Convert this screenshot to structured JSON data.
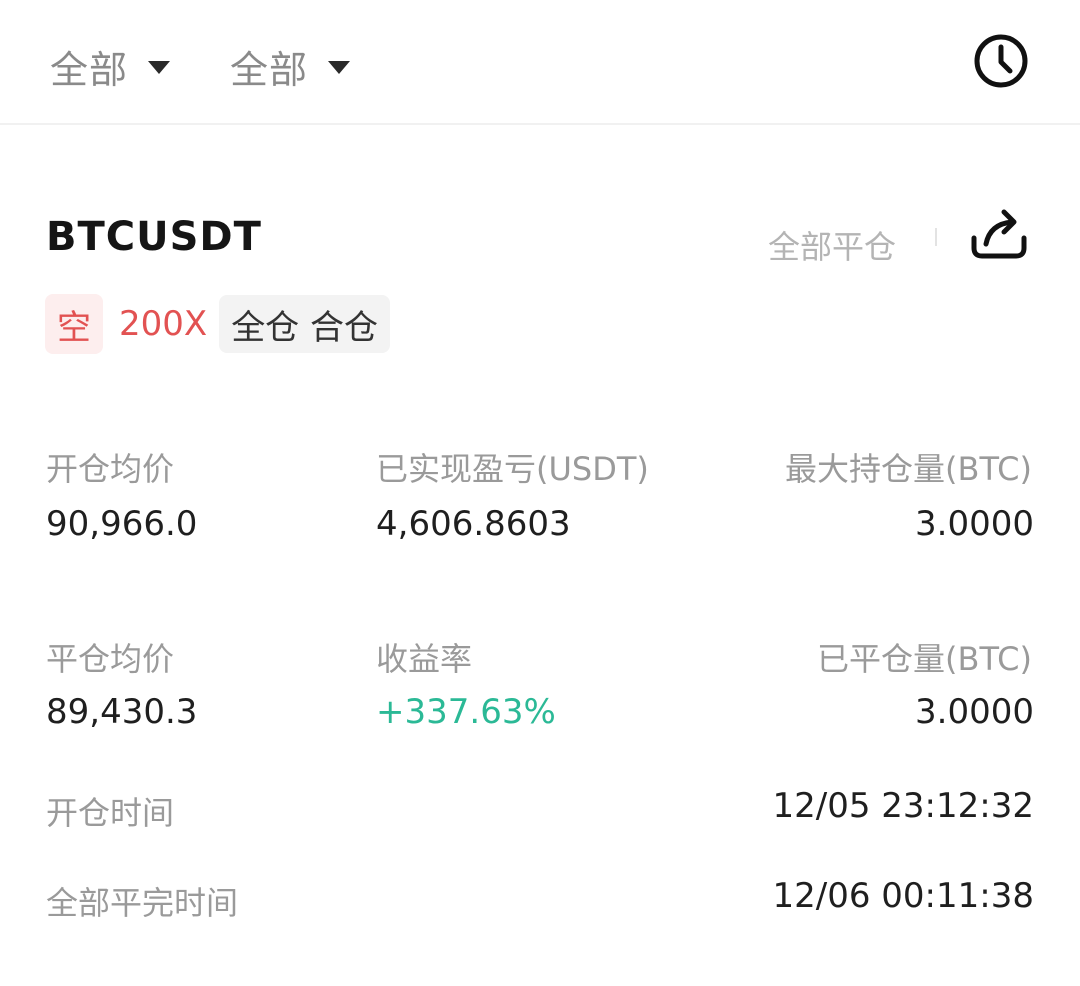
{
  "filters": [
    {
      "label": "全部"
    },
    {
      "label": "全部"
    }
  ],
  "position": {
    "symbol": "BTCUSDT",
    "close_all_label": "全部平仓",
    "side": "空",
    "leverage": "200X",
    "margin_mode": "全仓 合仓"
  },
  "stats": {
    "open_avg_price": {
      "label": "开仓均价",
      "value": "90,966.0"
    },
    "realized_pnl": {
      "label": "已实现盈亏(USDT)",
      "value": "4,606.8603"
    },
    "max_position": {
      "label": "最大持仓量(BTC)",
      "value": "3.0000"
    },
    "close_avg_price": {
      "label": "平仓均价",
      "value": "89,430.3"
    },
    "return_rate": {
      "label": "收益率",
      "value": "+337.63%"
    },
    "closed_volume": {
      "label": "已平仓量(BTC)",
      "value": "3.0000"
    },
    "open_time": {
      "label": "开仓时间",
      "value": "12/05 23:12:32"
    },
    "full_close_time": {
      "label": "全部平完时间",
      "value": "12/06 00:11:38"
    }
  },
  "colors": {
    "short": "#e25252",
    "profit": "#2bb996",
    "label_gray": "#9a9a9a"
  },
  "icons": {
    "history": "clock-icon",
    "share": "share-icon"
  }
}
